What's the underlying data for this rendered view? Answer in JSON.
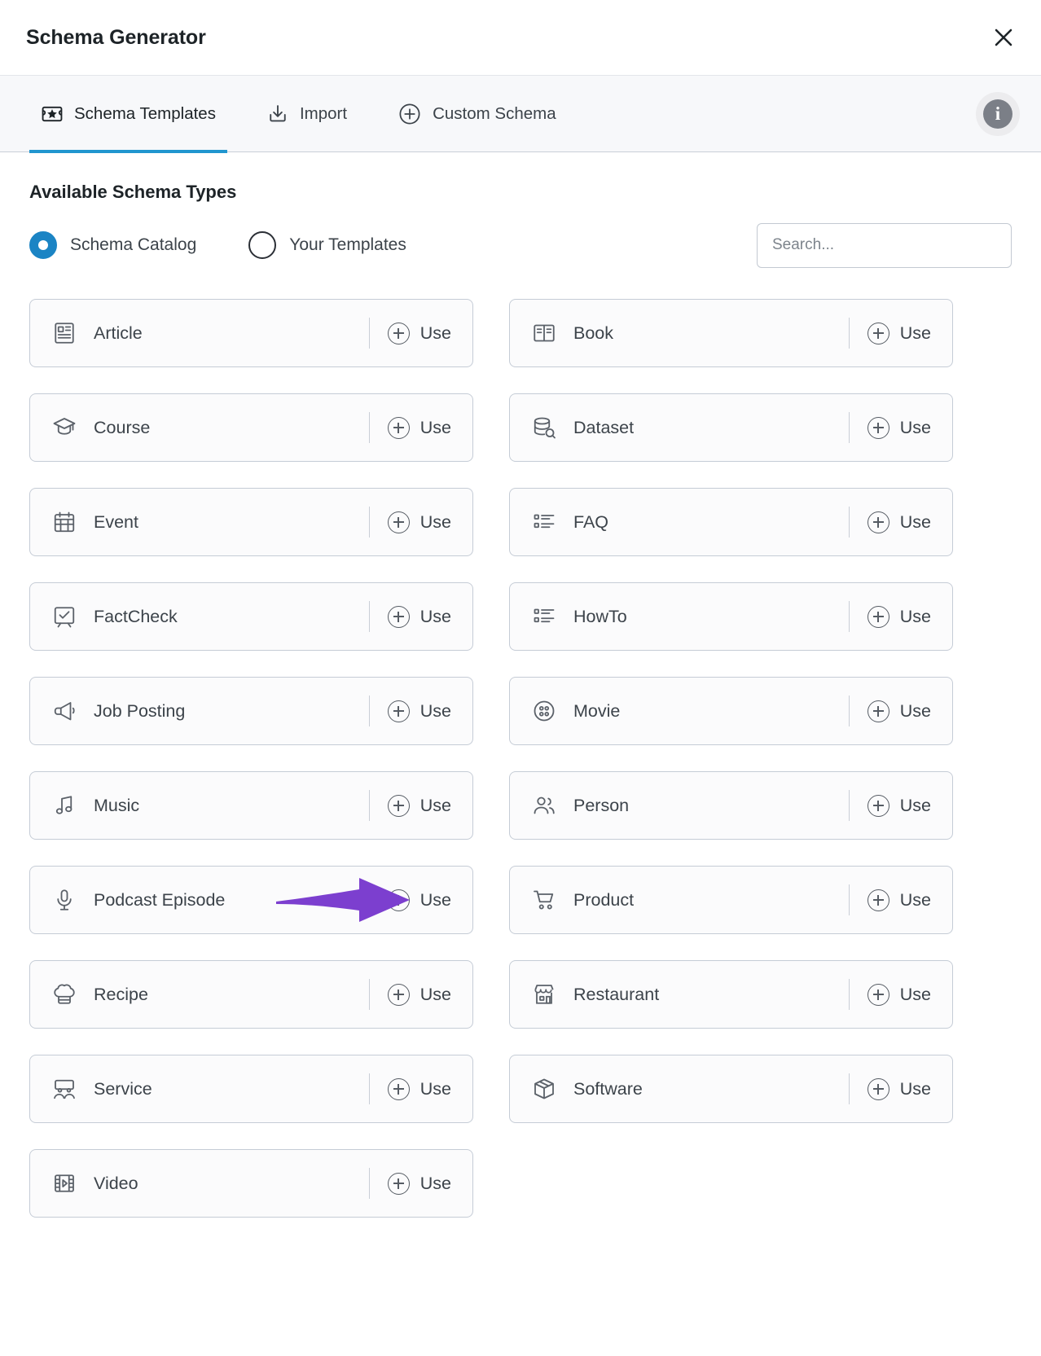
{
  "header": {
    "title": "Schema Generator",
    "close_icon": "close-icon"
  },
  "tabs": [
    {
      "label": "Schema Templates",
      "icon": "schema-template-icon",
      "active": true
    },
    {
      "label": "Import",
      "icon": "import-icon",
      "active": false
    },
    {
      "label": "Custom Schema",
      "icon": "plus-circle-icon",
      "active": false
    }
  ],
  "info_button": {
    "icon": "info-icon",
    "glyph": "i"
  },
  "main": {
    "section_title": "Available Schema Types",
    "radios": [
      {
        "label": "Schema Catalog",
        "checked": true
      },
      {
        "label": "Your Templates",
        "checked": false
      }
    ],
    "search": {
      "value": "",
      "placeholder": "Search..."
    },
    "use_label": "Use",
    "schema_types": [
      {
        "label": "Article",
        "icon": "article-icon",
        "column": "left",
        "annotated": false
      },
      {
        "label": "Book",
        "icon": "book-icon",
        "column": "right",
        "annotated": false
      },
      {
        "label": "Course",
        "icon": "course-icon",
        "column": "left",
        "annotated": false
      },
      {
        "label": "Dataset",
        "icon": "dataset-icon",
        "column": "right",
        "annotated": false
      },
      {
        "label": "Event",
        "icon": "event-icon",
        "column": "left",
        "annotated": false
      },
      {
        "label": "FAQ",
        "icon": "faq-list-icon",
        "column": "right",
        "annotated": false
      },
      {
        "label": "FactCheck",
        "icon": "factcheck-icon",
        "column": "left",
        "annotated": false
      },
      {
        "label": "HowTo",
        "icon": "howto-list-icon",
        "column": "right",
        "annotated": false
      },
      {
        "label": "Job Posting",
        "icon": "megaphone-icon",
        "column": "left",
        "annotated": false
      },
      {
        "label": "Movie",
        "icon": "movie-reel-icon",
        "column": "right",
        "annotated": false
      },
      {
        "label": "Music",
        "icon": "music-note-icon",
        "column": "left",
        "annotated": false
      },
      {
        "label": "Person",
        "icon": "person-icon",
        "column": "right",
        "annotated": false
      },
      {
        "label": "Podcast Episode",
        "icon": "microphone-icon",
        "column": "left",
        "annotated": true
      },
      {
        "label": "Product",
        "icon": "shopping-cart-icon",
        "column": "right",
        "annotated": false
      },
      {
        "label": "Recipe",
        "icon": "chef-hat-icon",
        "column": "left",
        "annotated": false
      },
      {
        "label": "Restaurant",
        "icon": "storefront-icon",
        "column": "right",
        "annotated": false
      },
      {
        "label": "Service",
        "icon": "service-desk-icon",
        "column": "left",
        "annotated": false
      },
      {
        "label": "Software",
        "icon": "package-box-icon",
        "column": "right",
        "annotated": false
      },
      {
        "label": "Video",
        "icon": "film-strip-icon",
        "column": "left",
        "annotated": false
      }
    ]
  },
  "colors": {
    "accent_tab_underline": "#2196cf",
    "radio_selected": "#1b84c4",
    "annotation_arrow": "#7c3fcf",
    "card_border": "#c5ccd6",
    "card_background": "#fbfbfc",
    "tabbar_background": "#f7f8fa",
    "text_primary": "#1d2327",
    "text_secondary": "#3c434a"
  }
}
